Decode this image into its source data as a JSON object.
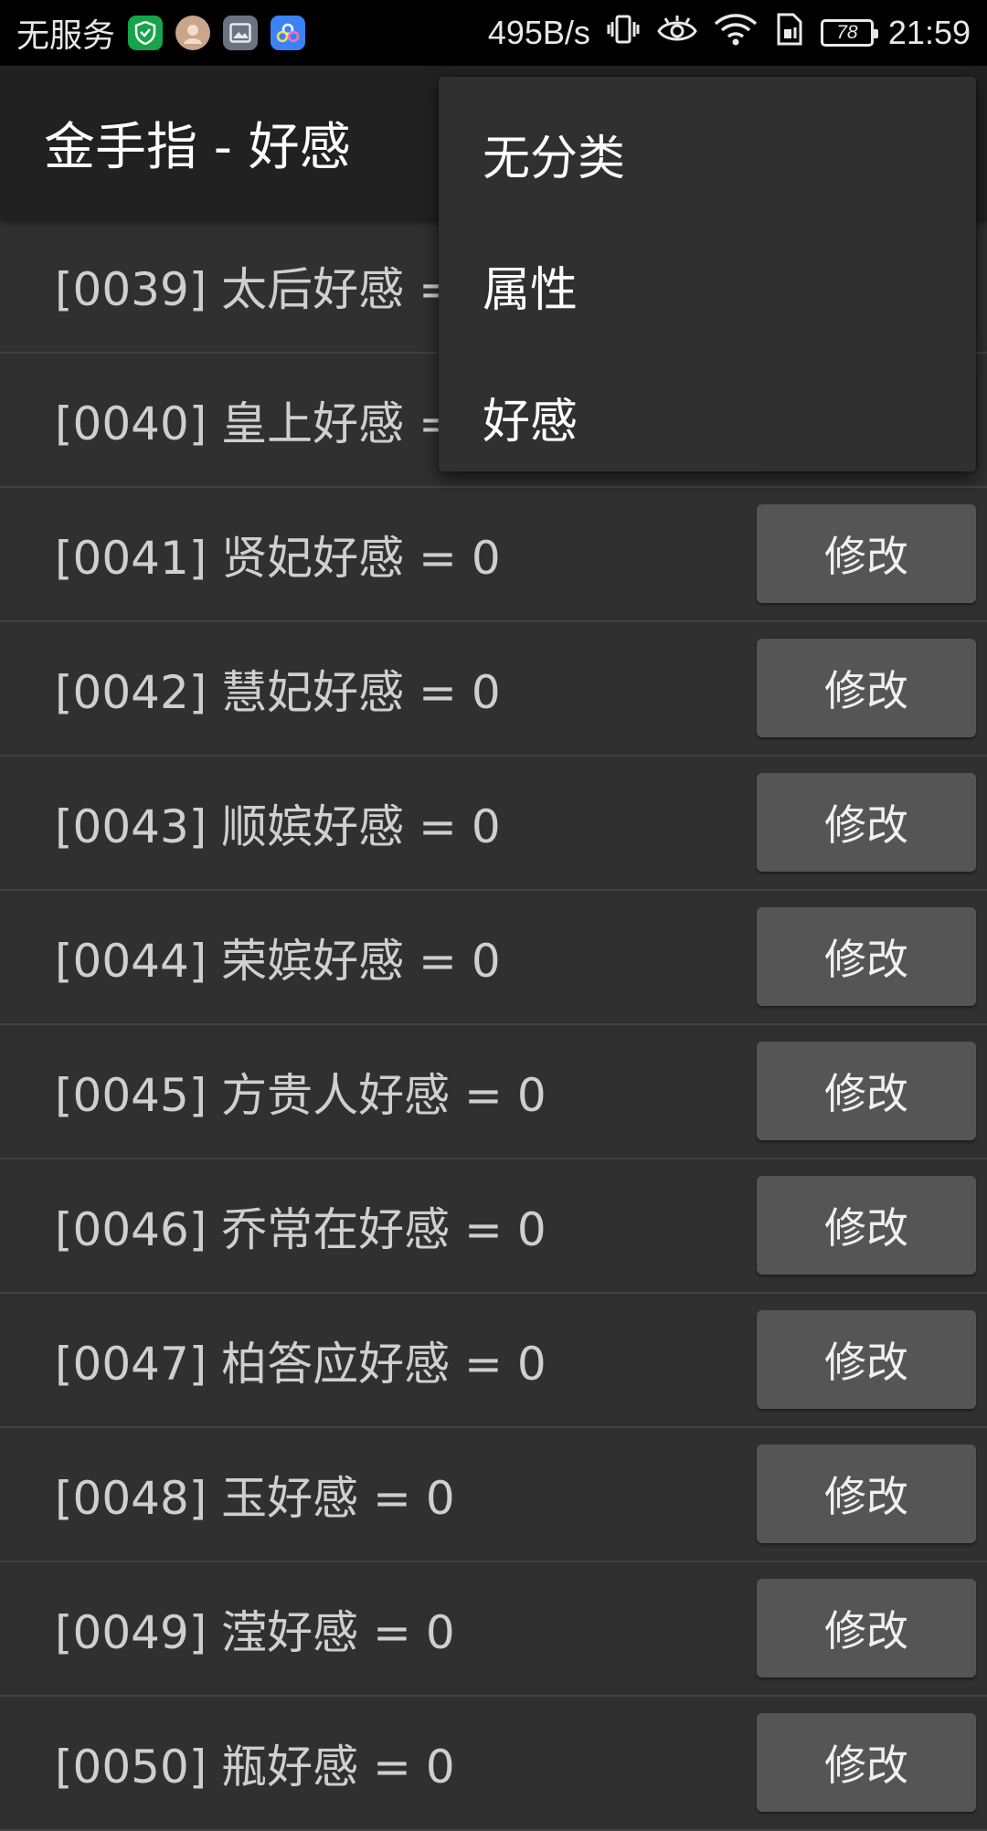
{
  "status_bar": {
    "carrier": "无服务",
    "app_icons": [
      "shield-app-icon",
      "avatar-app-icon",
      "gallery-app-icon",
      "baidu-app-icon"
    ],
    "net_speed": "495B/s",
    "battery_level": "78",
    "time": "21:59"
  },
  "app_bar": {
    "title": "金手指 - 好感"
  },
  "menu": {
    "items": [
      "无分类",
      "属性",
      "好感"
    ]
  },
  "list": {
    "button_label": "修改",
    "rows": [
      {
        "label": "[0039] 太后好感 = 0"
      },
      {
        "label": "[0040] 皇上好感 = 0"
      },
      {
        "label": "[0041] 贤妃好感 = 0"
      },
      {
        "label": "[0042] 慧妃好感 = 0"
      },
      {
        "label": "[0043] 顺嫔好感 = 0"
      },
      {
        "label": "[0044] 荣嫔好感 = 0"
      },
      {
        "label": "[0045] 方贵人好感 = 0"
      },
      {
        "label": "[0046] 乔常在好感 = 0"
      },
      {
        "label": "[0047] 柏答应好感 = 0"
      },
      {
        "label": "[0048] 玉好感 = 0"
      },
      {
        "label": "[0049] 滢好感 = 0"
      },
      {
        "label": "[0050] 瓶好感 = 0"
      }
    ]
  },
  "colors": {
    "background": "#303030",
    "app_bar": "#212121",
    "button": "#555555",
    "divider": "#424242"
  }
}
